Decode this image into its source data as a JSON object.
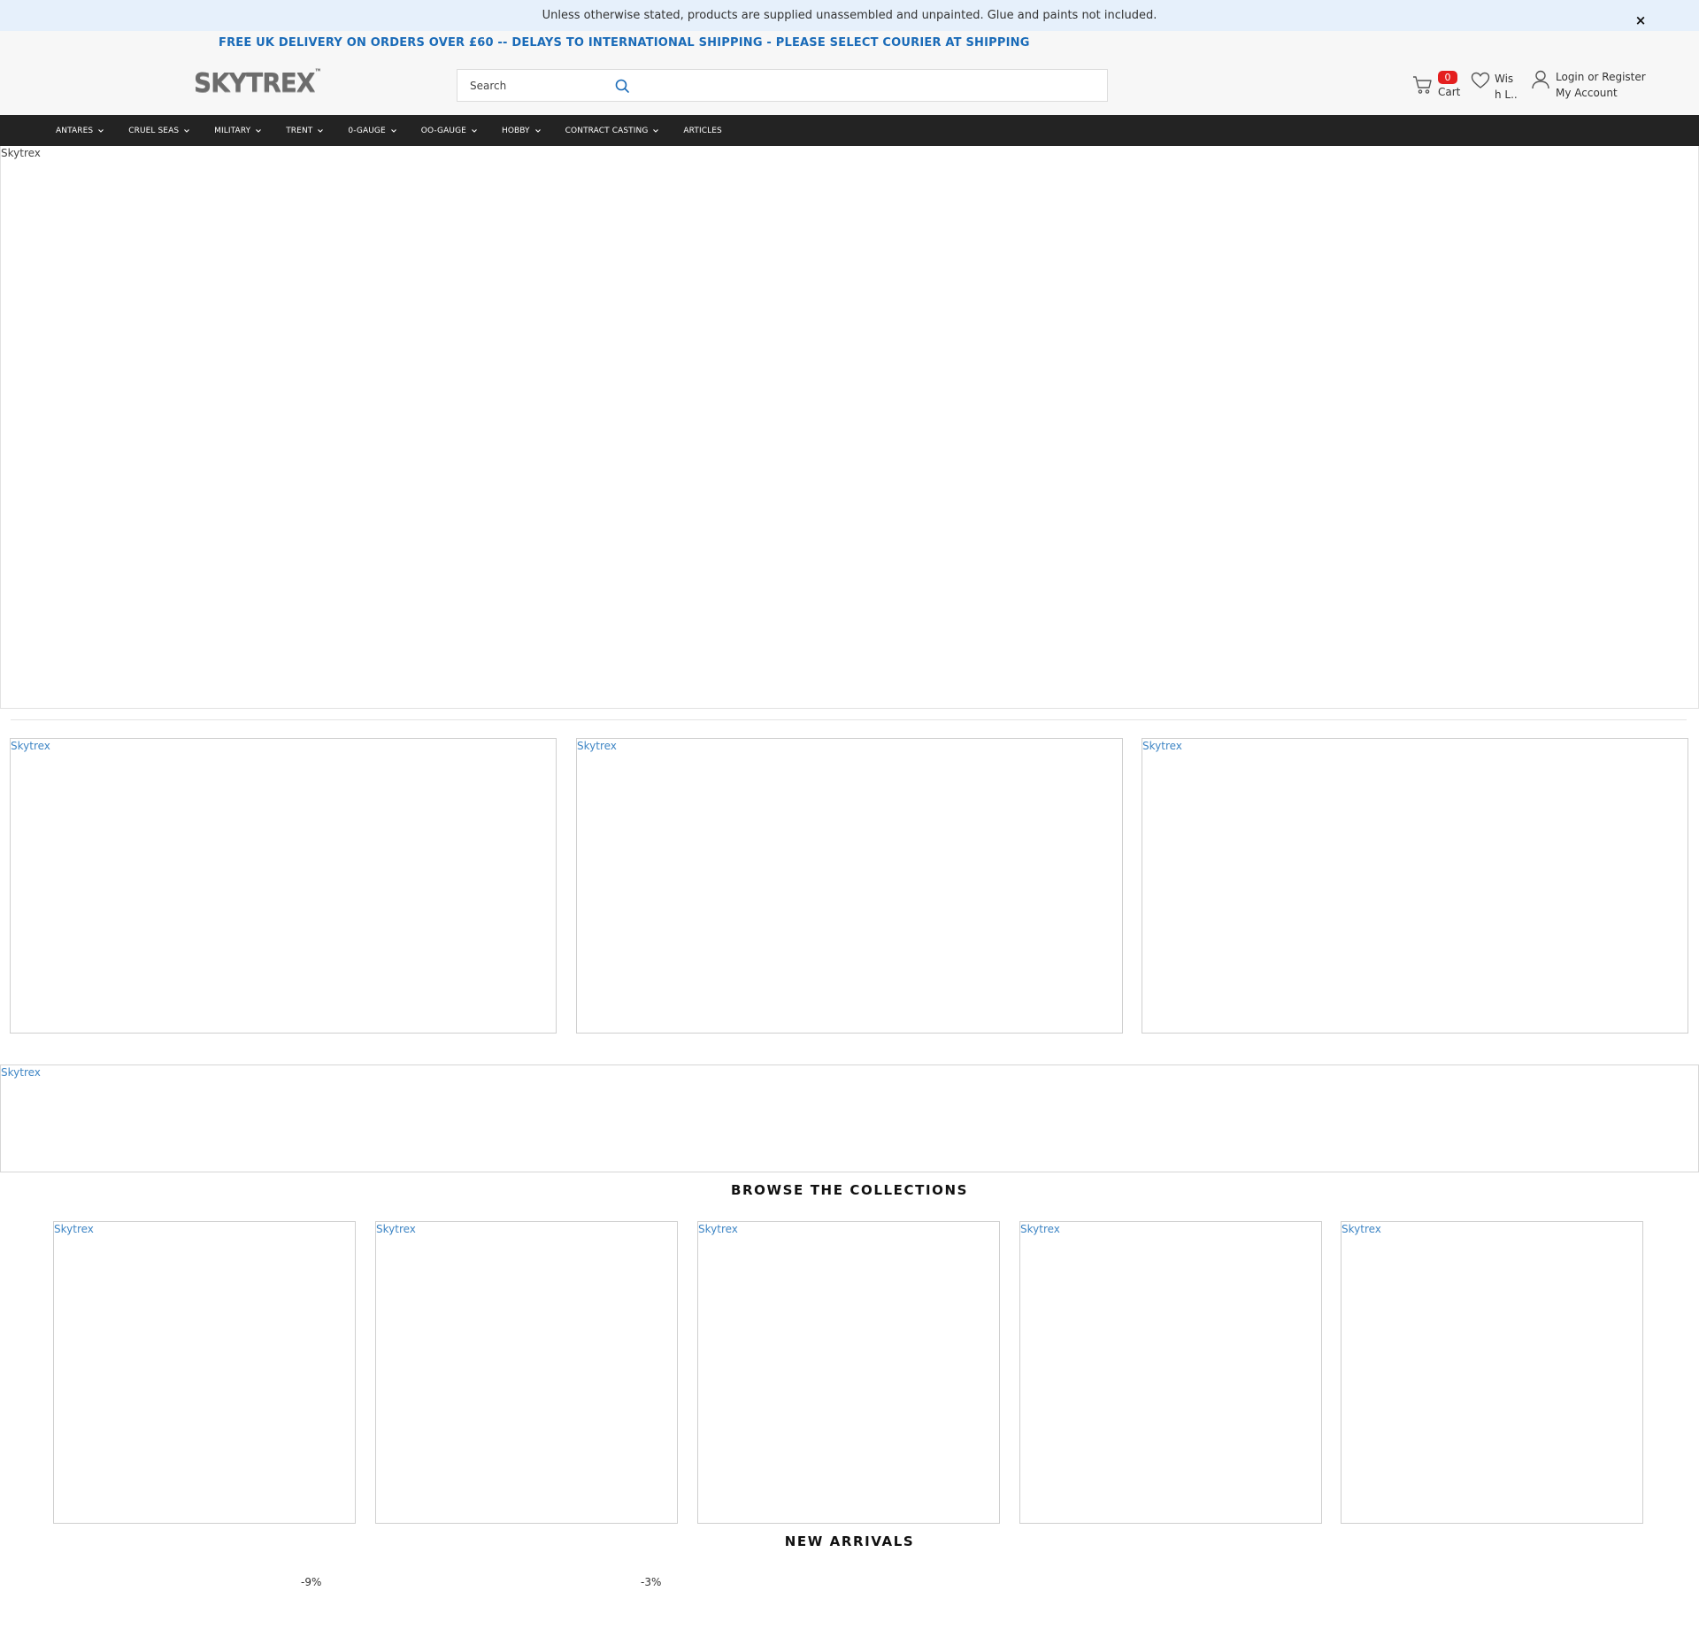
{
  "notice": {
    "text": "Unless otherwise stated, products are supplied unassembled and unpainted. Glue and paints not included.",
    "close_symbol": "×"
  },
  "header": {
    "promo": "FREE UK DELIVERY ON ORDERS OVER £60 -- DELAYS TO INTERNATIONAL SHIPPING - PLEASE SELECT COURIER AT SHIPPING",
    "logo": "SKYTREX",
    "logo_mark": "™",
    "search_placeholder": "Search",
    "cart_count": "0",
    "cart_label": "Cart",
    "wishlist_label": "Wish L..",
    "login_label": "Login or Register",
    "account_label": "My Account"
  },
  "nav": {
    "items": [
      {
        "label": "ANTARES",
        "dropdown": true
      },
      {
        "label": "CRUEL SEAS",
        "dropdown": true
      },
      {
        "label": "MILITARY",
        "dropdown": true
      },
      {
        "label": "TRENT",
        "dropdown": true
      },
      {
        "label": "0-GAUGE",
        "dropdown": true
      },
      {
        "label": "OO-GAUGE",
        "dropdown": true
      },
      {
        "label": "HOBBY",
        "dropdown": true
      },
      {
        "label": "CONTRACT CASTING",
        "dropdown": true
      },
      {
        "label": "ARTICLES",
        "dropdown": false
      }
    ]
  },
  "hero": {
    "alt": "Skytrex"
  },
  "feature_tiles": [
    {
      "alt": "Skytrex"
    },
    {
      "alt": "Skytrex"
    },
    {
      "alt": "Skytrex"
    }
  ],
  "banner": {
    "alt": "Skytrex"
  },
  "collections": {
    "title": "BROWSE THE COLLECTIONS",
    "items": [
      {
        "alt": "Skytrex"
      },
      {
        "alt": "Skytrex"
      },
      {
        "alt": "Skytrex"
      },
      {
        "alt": "Skytrex"
      },
      {
        "alt": "Skytrex"
      }
    ]
  },
  "new_arrivals": {
    "title": "NEW ARRIVALS",
    "badges": [
      "-9%",
      "-3%"
    ]
  },
  "colors": {
    "notice_bg": "#e6f0fb",
    "promo_text": "#1a6bb8",
    "nav_bg": "#232323",
    "cart_badge": "#e41e1e",
    "alt_link": "#3f86c5"
  }
}
